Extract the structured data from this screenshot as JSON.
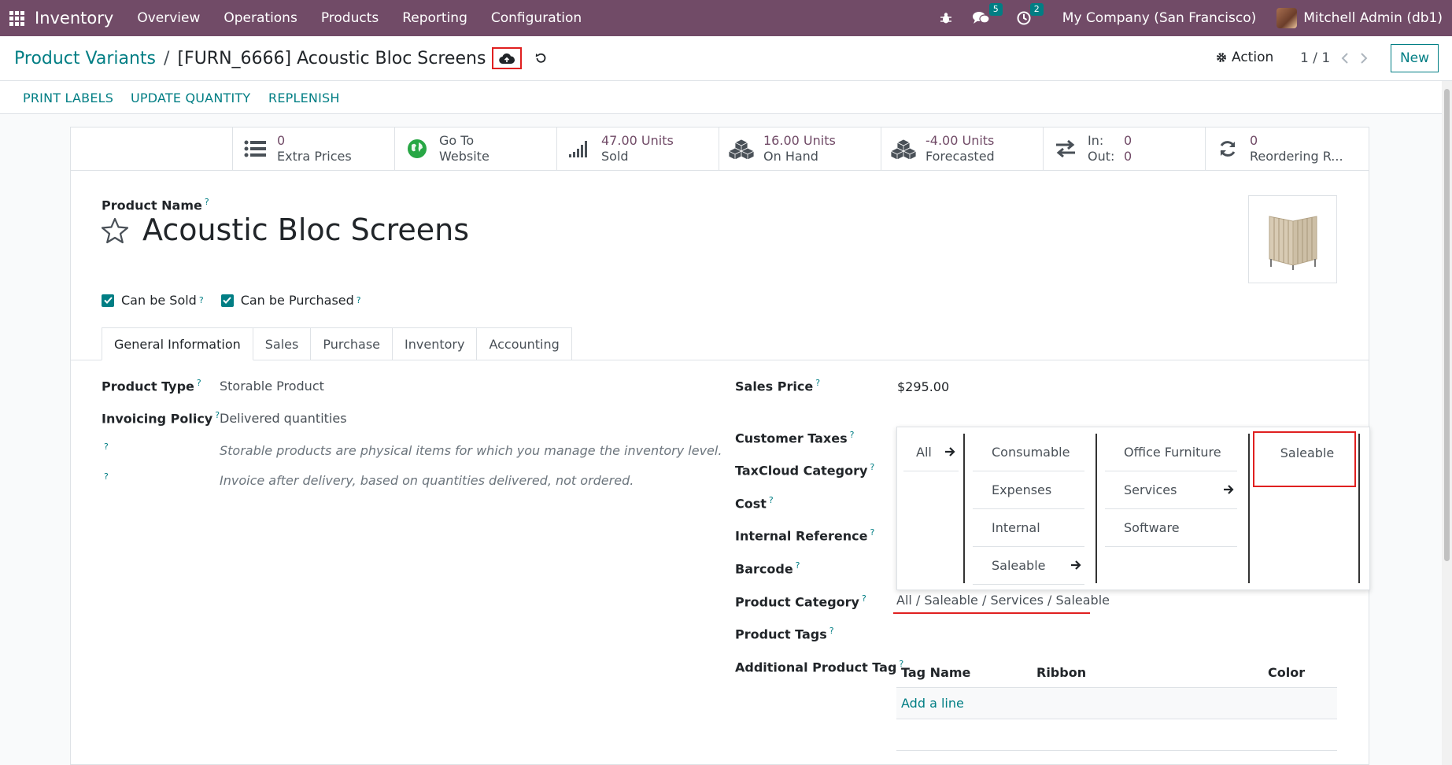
{
  "navbar": {
    "app_name": "Inventory",
    "menu": [
      "Overview",
      "Operations",
      "Products",
      "Reporting",
      "Configuration"
    ],
    "messages_count": "5",
    "activities_count": "2",
    "company": "My Company (San Francisco)",
    "user": "Mitchell Admin (db1)"
  },
  "breadcrumb": {
    "parent": "Product Variants",
    "separator": "/",
    "current": "[FURN_6666] Acoustic Bloc Screens"
  },
  "control": {
    "action_label": "Action",
    "pager": "1 / 1",
    "new_label": "New"
  },
  "status_buttons": [
    "PRINT LABELS",
    "UPDATE QUANTITY",
    "REPLENISH"
  ],
  "smart_buttons": {
    "extra_prices": {
      "value": "0",
      "label": "Extra Prices"
    },
    "website": {
      "value": "Go To",
      "label": "Website"
    },
    "sold": {
      "value": "47.00 Units",
      "label": "Sold"
    },
    "on_hand": {
      "value": "16.00 Units",
      "label": "On Hand"
    },
    "forecasted": {
      "value": "-4.00 Units",
      "label": "Forecasted"
    },
    "in_out": {
      "in_label": "In:",
      "in_value": "0",
      "out_label": "Out:",
      "out_value": "0"
    },
    "reordering": {
      "value": "0",
      "label": "Reordering R..."
    }
  },
  "form": {
    "product_name_label": "Product Name",
    "product_name": "Acoustic Bloc Screens",
    "can_be_sold": "Can be Sold",
    "can_be_purchased": "Can be Purchased",
    "help_mark": "?",
    "tabs": [
      "General Information",
      "Sales",
      "Purchase",
      "Inventory",
      "Accounting"
    ],
    "left_fields": {
      "product_type_label": "Product Type",
      "product_type": "Storable Product",
      "invoicing_policy_label": "Invoicing Policy",
      "invoicing_policy": "Delivered quantities",
      "note1": "Storable products are physical items for which you manage the inventory level.",
      "note2": "Invoice after delivery, based on quantities delivered, not ordered."
    },
    "right_fields": {
      "sales_price_label": "Sales Price",
      "sales_price": "$295.00",
      "customer_taxes_label": "Customer Taxes",
      "taxcloud_label": "TaxCloud Category",
      "cost_label": "Cost",
      "internal_ref_label": "Internal Reference",
      "barcode_label": "Barcode",
      "category_label": "Product Category",
      "category_value": "All / Saleable / Services / Saleable",
      "tags_label": "Product Tags",
      "additional_tag_label": "Additional Product Tag"
    },
    "tag_table": {
      "col_name": "Tag Name",
      "col_ribbon": "Ribbon",
      "col_color": "Color",
      "add_line": "Add a line"
    }
  },
  "category_dropdown": {
    "col1": [
      "All"
    ],
    "col2": [
      "Consumable",
      "Expenses",
      "Internal",
      "Saleable"
    ],
    "col3": [
      "Office Furniture",
      "Services",
      "Software"
    ],
    "col4": [
      "Saleable"
    ]
  }
}
